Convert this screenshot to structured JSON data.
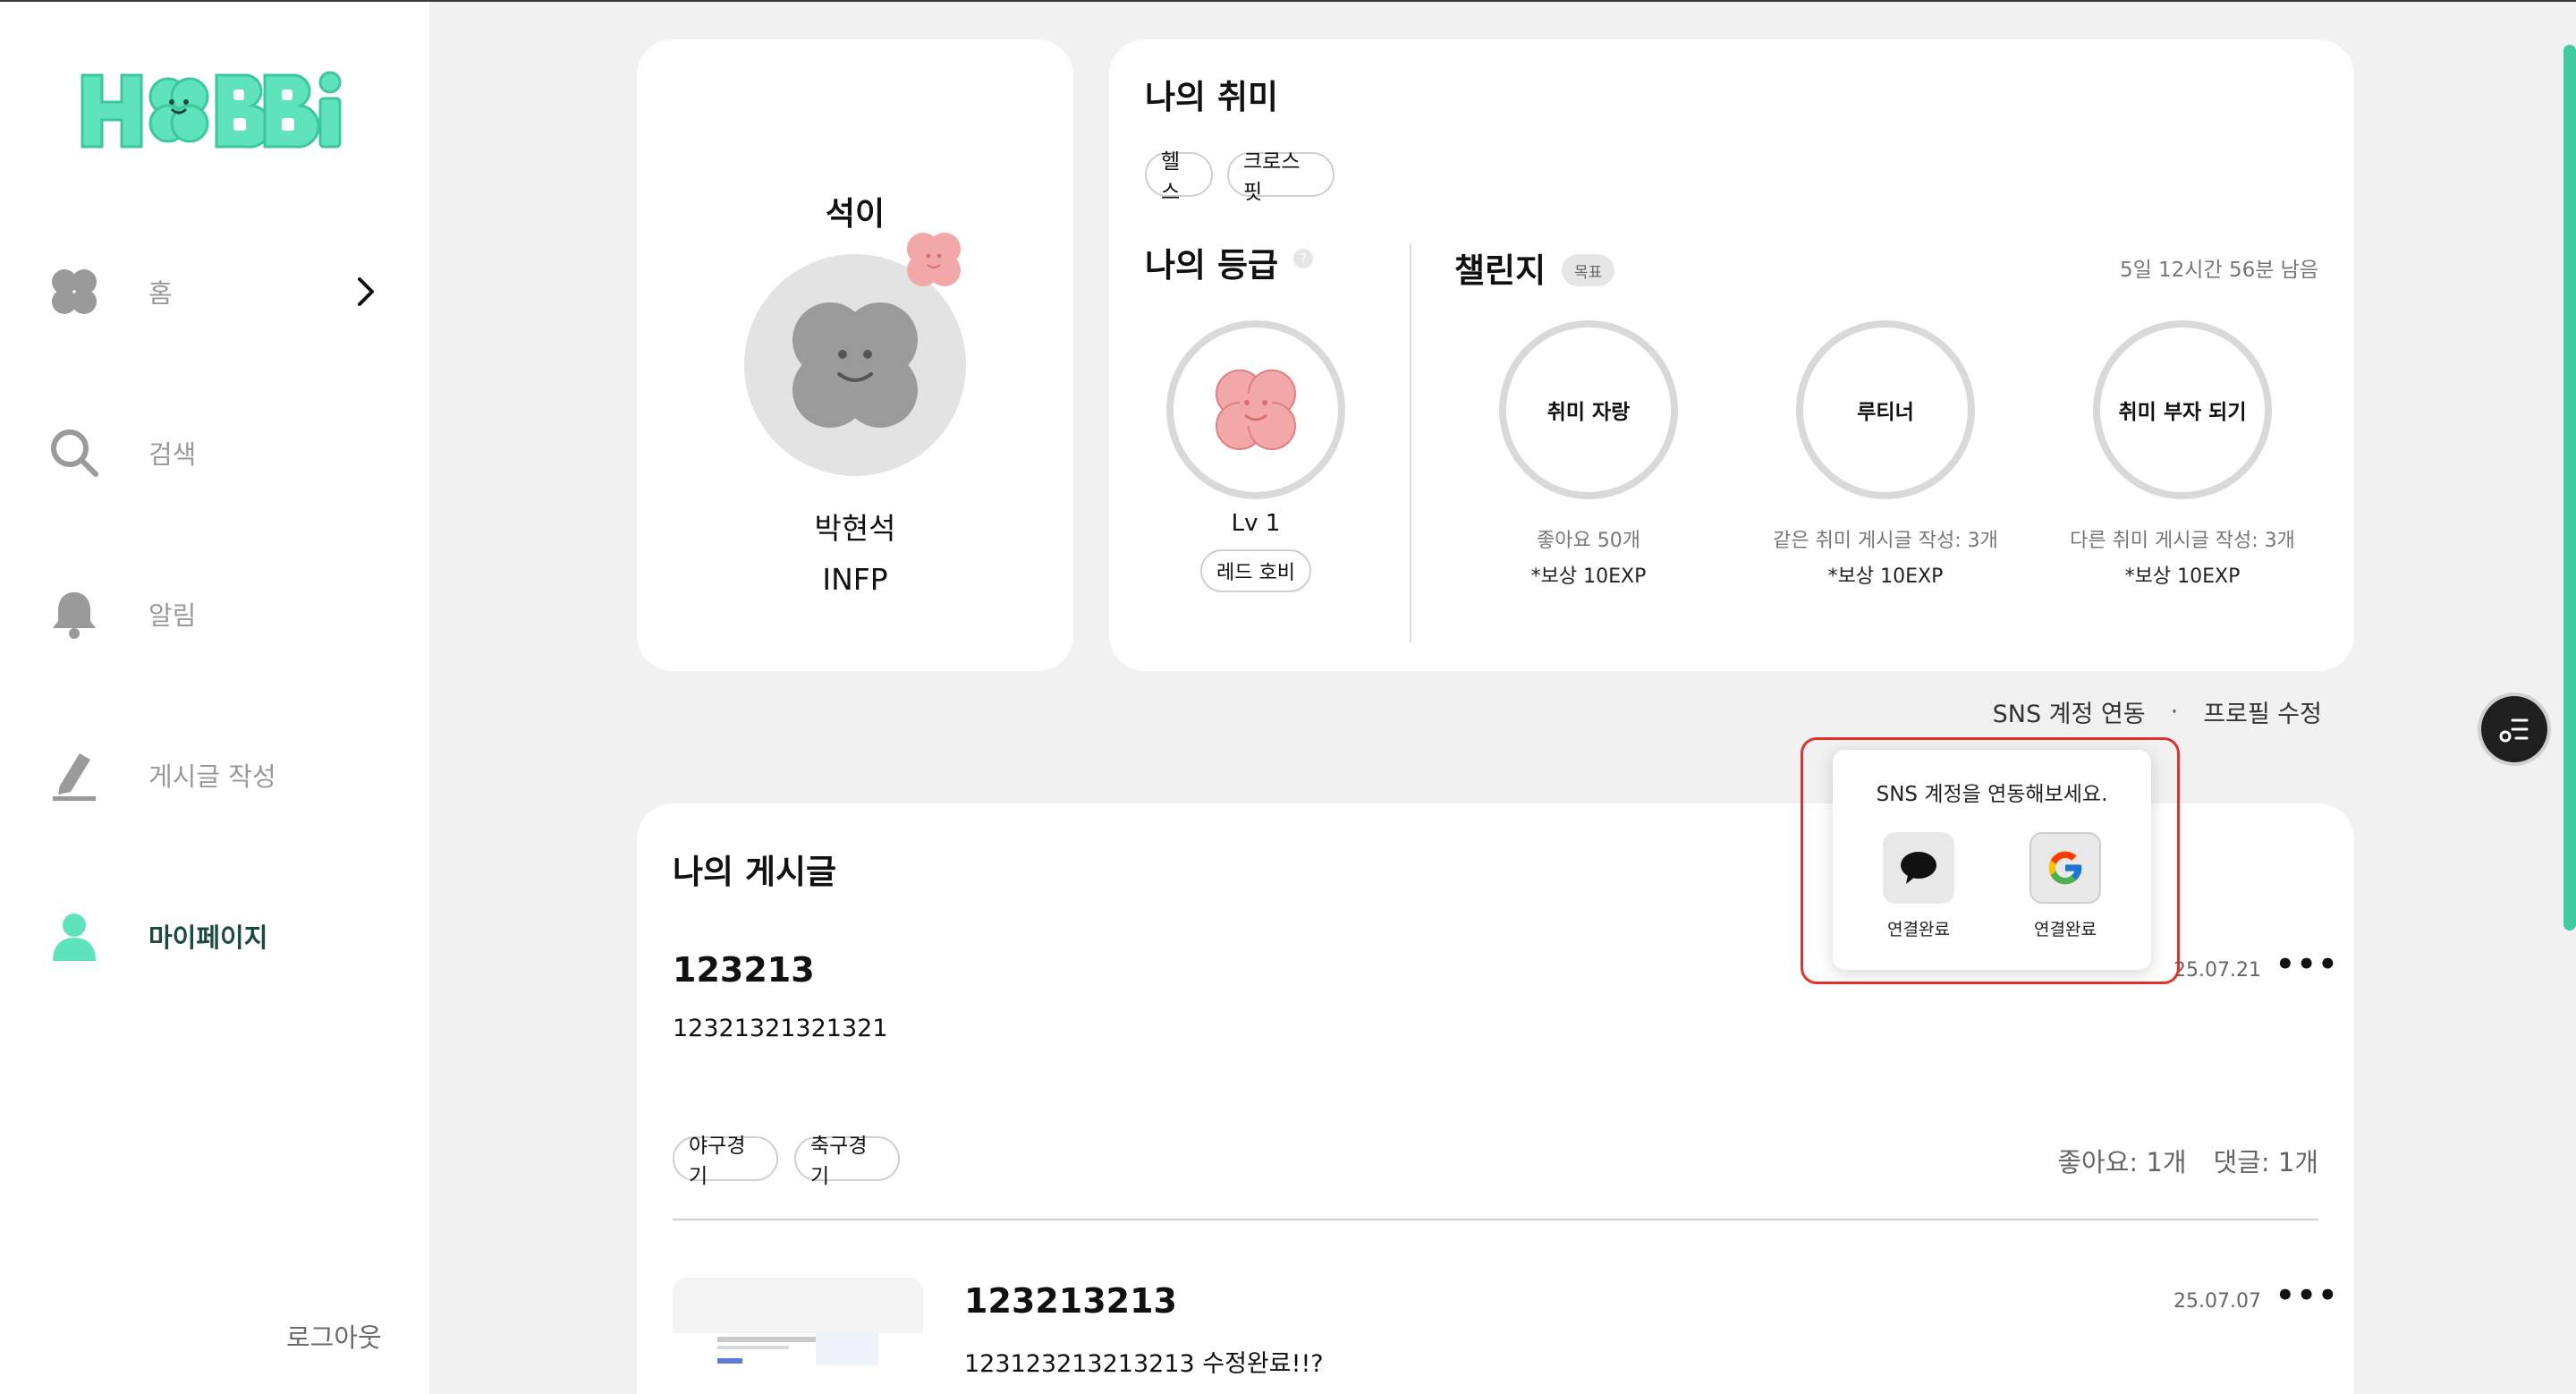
{
  "app": {
    "logo_text": "HOBBi",
    "brand_color": "#5fe3bb",
    "accent_dark": "#1c4a40"
  },
  "sidebar": {
    "items": [
      {
        "label": "홈",
        "icon": "clover-icon"
      },
      {
        "label": "검색",
        "icon": "search-icon"
      },
      {
        "label": "알림",
        "icon": "bell-icon"
      },
      {
        "label": "게시글 작성",
        "icon": "pencil-icon"
      },
      {
        "label": "마이페이지",
        "icon": "user-icon",
        "active": true
      }
    ],
    "logout": "로그아웃"
  },
  "profile": {
    "nickname": "석이",
    "name": "박현석",
    "mbti": "INFP"
  },
  "hobbies": {
    "title": "나의 취미",
    "tags": [
      "헬스",
      "크로스핏"
    ]
  },
  "grade": {
    "title": "나의 등급",
    "help": "?",
    "level": "Lv 1",
    "grade_name": "레드 호비"
  },
  "challenge": {
    "title": "챌린지",
    "badge": "목표",
    "remaining": "5일 12시간 56분 남음",
    "items": [
      {
        "name": "취미 자랑",
        "desc": "좋아요 50개",
        "reward": "*보상 10EXP"
      },
      {
        "name": "루티너",
        "desc": "같은 취미 게시글 작성: 3개",
        "reward": "*보상 10EXP"
      },
      {
        "name": "취미 부자 되기",
        "desc": "다른 취미 게시글 작성: 3개",
        "reward": "*보상 10EXP"
      }
    ]
  },
  "links": {
    "sns": "SNS 계정 연동",
    "separator": "·",
    "edit_profile": "프로필 수정"
  },
  "sns_popup": {
    "message": "SNS 계정을 연동해보세요.",
    "kakao_label": "연결완료",
    "google_label": "연결완료"
  },
  "posts": {
    "title": "나의 게시글",
    "items": [
      {
        "title": "123213",
        "body": "12321321321321",
        "date": "25.07.21",
        "tags": [
          "야구경기",
          "축구경기"
        ],
        "likes": "좋아요: 1개",
        "comments": "댓글: 1개",
        "more": "•••"
      },
      {
        "title": "123213213",
        "body": "123123213213213 수정완료!!?",
        "date": "25.07.07",
        "more": "•••"
      }
    ]
  }
}
